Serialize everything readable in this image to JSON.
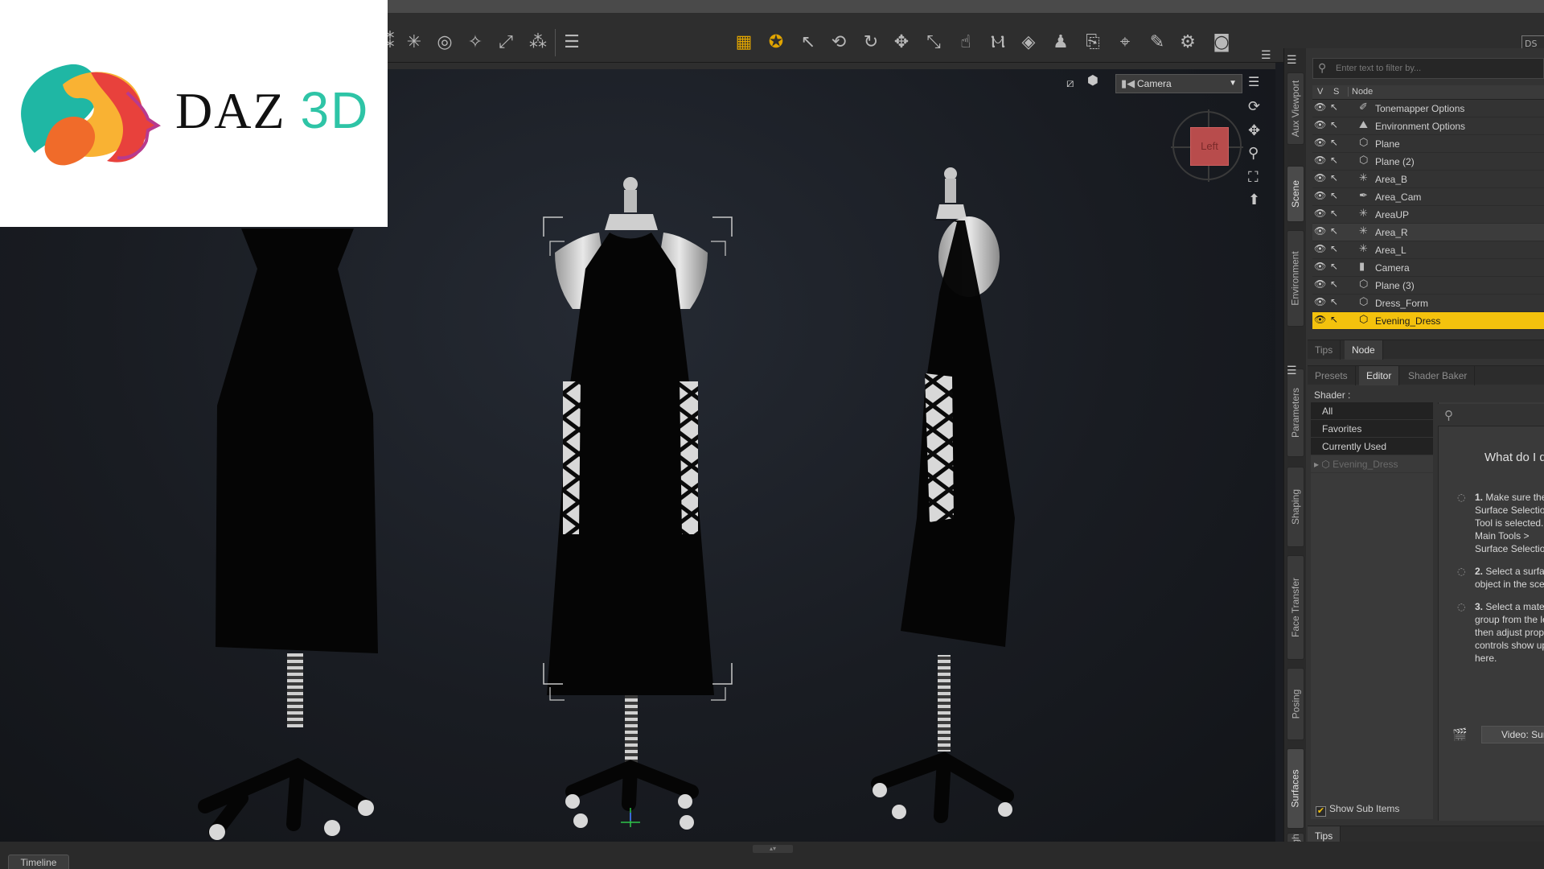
{
  "toolbar": {
    "tools": [
      "spot-render-icon",
      "joint-editor-icon",
      "node-weight-icon",
      "geometry-editor-icon",
      "transform-icon",
      "surface-selection-icon",
      "align-icon",
      "viewport-grid-icon",
      "universal-tool-icon",
      "node-selection-icon",
      "rotate-icon",
      "translate-icon",
      "scale-icon",
      "active-pose-icon",
      "power-pose-icon",
      "geometry-sculptor-icon",
      "region-navigator-icon",
      "figure-setup-icon",
      "camera-tool-icon",
      "selection-tool-icon",
      "render-settings-icon",
      "render-icon",
      "screenshot-icon"
    ],
    "ds_label": "DS"
  },
  "logo": {
    "text_main": "DAZ",
    "text_accent": "3D",
    "colors": {
      "orange": "#f06b2a",
      "teal": "#1fb7a4",
      "yellow": "#f9b233",
      "red": "#e8413c"
    }
  },
  "viewport": {
    "camera_select": "Camera",
    "cube_label": "Left",
    "background": "#1a1c21"
  },
  "sidebar_tabs_top": [
    "Aux Viewport",
    "Scene",
    "Environment"
  ],
  "sidebar_tabs_bottom": [
    "Parameters",
    "Shaping",
    "Face Transfer",
    "Posing",
    "Surfaces",
    "Lights"
  ],
  "scene": {
    "filter_placeholder": "Enter text to filter by...",
    "header": {
      "v": "V",
      "s": "S",
      "node": "Node"
    },
    "nodes": [
      {
        "label": "Tonemapper Options",
        "icon": "brush-icon"
      },
      {
        "label": "Environment Options",
        "icon": "environment-icon"
      },
      {
        "label": "Plane",
        "icon": "primitive-icon"
      },
      {
        "label": "Plane (2)",
        "icon": "primitive-icon"
      },
      {
        "label": "Area_B",
        "icon": "light-icon"
      },
      {
        "label": "Area_Cam",
        "icon": "light-icon"
      },
      {
        "label": "AreaUP",
        "icon": "light-icon"
      },
      {
        "label": "Area_R",
        "icon": "light-icon"
      },
      {
        "label": "Area_L",
        "icon": "light-icon"
      },
      {
        "label": "Camera",
        "icon": "camera-icon"
      },
      {
        "label": "Plane (3)",
        "icon": "primitive-icon"
      },
      {
        "label": "Dress_Form",
        "icon": "primitive-icon"
      },
      {
        "label": "Evening_Dress",
        "icon": "primitive-icon"
      }
    ],
    "selected_node": "Evening_Dress",
    "selected_color": "#f4c20d",
    "bottom_tabs": [
      "Tips",
      "Node"
    ]
  },
  "surfaces": {
    "tabs": [
      "Presets",
      "Editor",
      "Shader Baker"
    ],
    "active_tab": "Editor",
    "shader_label": "Shader :",
    "shader_filters": [
      "All",
      "Favorites",
      "Currently Used"
    ],
    "node": "Evening_Dress",
    "show_sub_items": "Show Sub Items",
    "bottom_tab": "Tips",
    "help": {
      "title": "What do I do?",
      "steps": [
        {
          "num": "1.",
          "text": "Make sure the Surface Selection Tool is selected. Main Tools > Surface Selection."
        },
        {
          "num": "2.",
          "text": "Select a surface object in the scene."
        },
        {
          "num": "3.",
          "text": "Select a material group from the left, then adjust property controls show up here."
        }
      ],
      "video_button": "Video: Surfaces"
    }
  },
  "bottom": {
    "timeline_tab": "Timeline"
  }
}
